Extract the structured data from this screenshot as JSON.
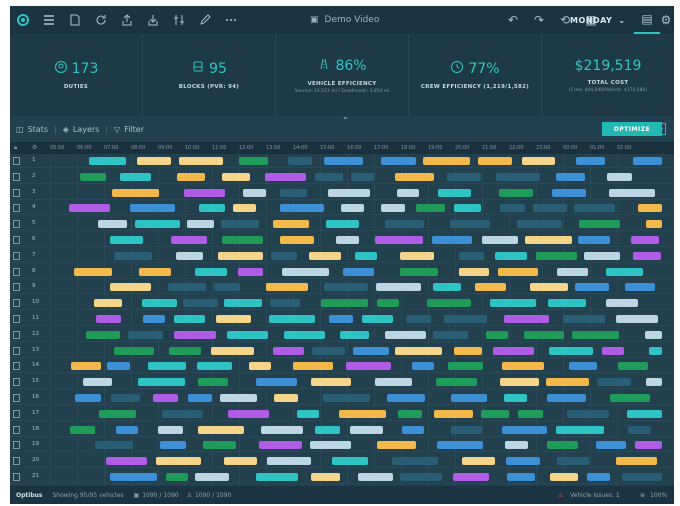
{
  "toolbar": {
    "doc_title": "Demo Video",
    "day": "MONDAY",
    "icons": [
      "logo-icon",
      "menu-icon",
      "open-file-icon",
      "refresh-icon",
      "export-icon",
      "import-icon",
      "sliders-icon",
      "edit-icon",
      "more-icon"
    ]
  },
  "kpis": [
    {
      "icon": "duties-icon",
      "value": "173",
      "label": "DUTIES",
      "sub": ""
    },
    {
      "icon": "bus-icon",
      "value": "95",
      "label": "BLOCKS (PVR: 94)",
      "sub": ""
    },
    {
      "icon": "road-icon",
      "value": "86%",
      "label": "VEHICLE EFFICIENCY",
      "sub": "Service: 24,541 mi / Deadheads: 3,854 mi"
    },
    {
      "icon": "clock-icon",
      "value": "77%",
      "label": "CREW EFFICIENCY (1,219/1,582)",
      "sub": ""
    },
    {
      "icon": "",
      "value": "$219,519",
      "label": "TOTAL COST",
      "sub": "(Crew: $44,940/Vehicle: $170,580)"
    }
  ],
  "subbar": {
    "stats": "Stats",
    "layers": "Layers",
    "filter": "Filter",
    "optimize": "OPTIMIZE"
  },
  "timeline": [
    "05:00",
    "06:00",
    "07:00",
    "08:00",
    "09:00",
    "10:00",
    "11:00",
    "12:00",
    "13:00",
    "14:00",
    "15:00",
    "16:00",
    "17:00",
    "18:00",
    "19:00",
    "20:00",
    "21:00",
    "22:00",
    "23:00",
    "00:00",
    "01:00",
    "02:00"
  ],
  "rows": [
    "1",
    "2",
    "3",
    "4",
    "5",
    "6",
    "7",
    "8",
    "9",
    "10",
    "11",
    "12",
    "13",
    "14",
    "15",
    "16",
    "17",
    "18",
    "19",
    "20",
    "21"
  ],
  "status": {
    "brand": "Optibus",
    "vehicles": "Showing 95/95 vehicles",
    "blocks": "1090 / 1090",
    "duties": "1090 / 1090",
    "issues": "Vehicle Issues: 1",
    "zoom": "100%"
  },
  "colors": {
    "teal": "#2ec4c4",
    "blue": "#3d8fd6",
    "light": "#bcd6e6",
    "yellow": "#f5d58a",
    "purple": "#b05ce6",
    "green": "#1f9c5a",
    "orange": "#f3b94a",
    "dark": "#2a5e75"
  }
}
